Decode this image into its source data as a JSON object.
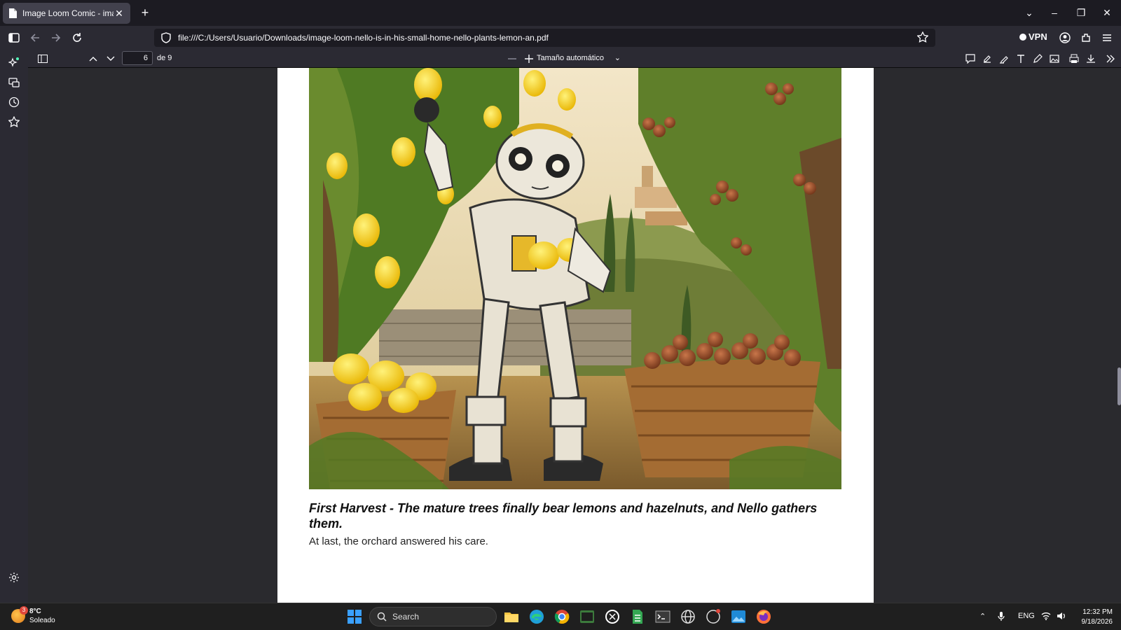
{
  "browser": {
    "tab_title": "Image Loom Comic - image-lo",
    "url": "file:///C:/Users/Usuario/Downloads/image-loom-nello-is-in-his-small-home-nello-plants-lemon-an.pdf",
    "vpn_label": "VPN"
  },
  "pdf_toolbar": {
    "page_value": "6",
    "page_count": "de 9",
    "zoom_value": "Tamaño automático"
  },
  "page": {
    "heading": "First Harvest - The mature trees finally bear lemons and hazelnuts, and Nello gathers them.",
    "body": "At last, the orchard answered his care."
  },
  "taskbar": {
    "weather_temp": "8°C",
    "weather_condition": "Soleado",
    "weather_badge": "3",
    "search_placeholder": "Search",
    "language": "ENG",
    "time": "12:32 PM",
    "date": "9/18/2026"
  },
  "colors": {
    "chrome_dark": "#1c1b22",
    "chrome_mid": "#2b2a33",
    "viewer_bg": "#2a2a2e",
    "accent_blue": "#0a84ff"
  }
}
